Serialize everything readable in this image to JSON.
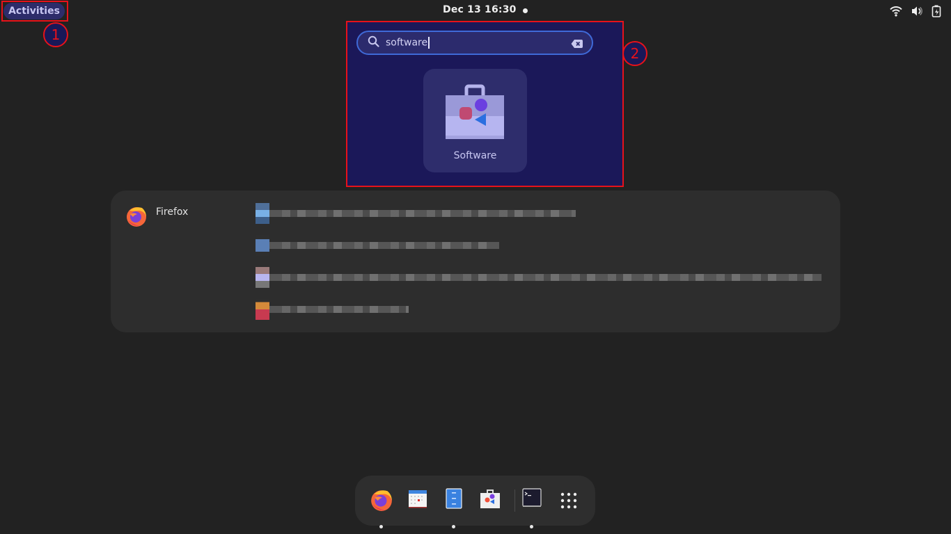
{
  "topbar": {
    "activities_label": "Activities",
    "clock": "Dec 13  16:30",
    "tray_icons": [
      "wifi-icon",
      "volume-icon",
      "battery-charging-icon"
    ]
  },
  "search": {
    "query": "software",
    "clear_icon": "clear-text-icon",
    "search_icon": "search-icon"
  },
  "app_results": [
    {
      "name": "Software",
      "icon": "software-store-icon"
    }
  ],
  "provider_results": {
    "provider_name": "Firefox",
    "provider_icon": "firefox-icon",
    "items": [
      {
        "text": "[redacted]"
      },
      {
        "text": "[redacted]"
      },
      {
        "text": "[redacted]"
      },
      {
        "text": "[redacted]"
      }
    ]
  },
  "dock": {
    "items": [
      {
        "name": "Firefox",
        "icon": "firefox-icon",
        "running": true
      },
      {
        "name": "Calendar",
        "icon": "calendar-icon",
        "running": false
      },
      {
        "name": "Files",
        "icon": "files-icon",
        "running": true
      },
      {
        "name": "Software",
        "icon": "software-store-icon",
        "running": false
      },
      {
        "name": "Terminal",
        "icon": "terminal-icon",
        "running": true
      },
      {
        "name": "Show Applications",
        "icon": "app-grid-icon",
        "running": false
      }
    ]
  },
  "annotations": [
    {
      "label": "1"
    },
    {
      "label": "2"
    }
  ],
  "colors": {
    "annotation": "#e8121a",
    "search_focus": "#3f6ad8",
    "highlight_bg": "#1b1859"
  }
}
